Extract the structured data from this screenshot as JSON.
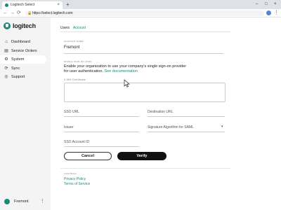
{
  "browser": {
    "tab_title": "Logitech Select",
    "tab_close": "×",
    "new_tab": "+",
    "win_minimize": "–",
    "win_maximize": "□",
    "win_close": "×",
    "back": "←",
    "forward": "→",
    "reload": "⟳",
    "lock": "🔒",
    "url": "https://select.logitech.com",
    "menu": "⋮"
  },
  "sidebar": {
    "logo_text": "logitech",
    "items": [
      {
        "label": "Dashboard",
        "icon": "home-icon",
        "glyph": "⌂"
      },
      {
        "label": "Service Orders",
        "icon": "document-icon",
        "glyph": "▤"
      },
      {
        "label": "System",
        "icon": "gear-icon",
        "glyph": "⚙"
      },
      {
        "label": "Sync",
        "icon": "sync-icon",
        "glyph": "⟳"
      },
      {
        "label": "Support",
        "icon": "support-icon",
        "glyph": "◎"
      }
    ],
    "active_item": "System",
    "user_name": "Fremont",
    "user_menu": "⋮"
  },
  "tabs": [
    {
      "label": "Users"
    },
    {
      "label": "Account",
      "active": true
    }
  ],
  "account": {
    "name_label": "ACCOUNT NAME",
    "name_value": "Fremont"
  },
  "sso": {
    "heading": "SINGLE SIGN-ON (SSO)",
    "description": "Enable your organization to use your company's single sign-on provider for user authentication.",
    "link": "See documentation",
    "cert_label": "X.509 Certificate",
    "sso_url_label": "SSO URL",
    "destination_url_label": "Destination URL",
    "issuer_label": "Issuer",
    "signature_label": "Signature Algorithm for SAML",
    "signature_caret": "▾",
    "account_id_label": "SSO Account ID",
    "cancel_label": "Cancel",
    "verify_label": "Verify"
  },
  "legal": {
    "heading": "LOGITECH",
    "privacy": "Privacy Policy",
    "terms": "Terms of Service"
  },
  "colors": {
    "accent": "#1a8a78",
    "primary_button": "#111111",
    "sidebar_bg": "#f4f4f4"
  }
}
